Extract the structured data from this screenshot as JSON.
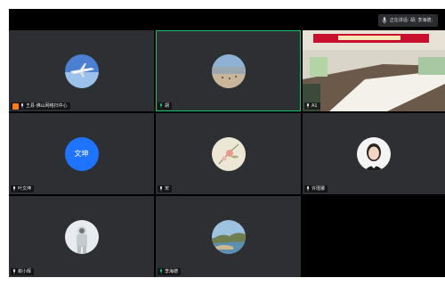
{
  "speaking_indicator": {
    "text": "正在讲话: 胡; 李海德;"
  },
  "participants": [
    {
      "name": "王县·佛山网络扫中心",
      "avatar": "airplane-image",
      "host_badge": true,
      "active": false
    },
    {
      "name": "胡",
      "avatar": "beach-image",
      "host_badge": false,
      "active": true
    },
    {
      "name": "A1",
      "avatar": "conference-room-video",
      "host_badge": false,
      "active": false
    },
    {
      "name": "叶文坤",
      "avatar_text": "文坤",
      "avatar_color": "#1f74ff",
      "host_badge": false,
      "active": false
    },
    {
      "name": "宋",
      "avatar": "flower-painting",
      "host_badge": false,
      "active": false
    },
    {
      "name": "许瑾娜",
      "avatar": "woman-portrait",
      "host_badge": false,
      "active": false
    },
    {
      "name": "谢小辉",
      "avatar": "astronaut-image",
      "host_badge": false,
      "active": false
    },
    {
      "name": "李海德",
      "avatar": "coast-image",
      "host_badge": false,
      "active": false
    }
  ],
  "colors": {
    "background": "#000000",
    "tile": "#2d2f33",
    "active_border": "#16c26a",
    "host_badge": "#ff7a1a"
  }
}
